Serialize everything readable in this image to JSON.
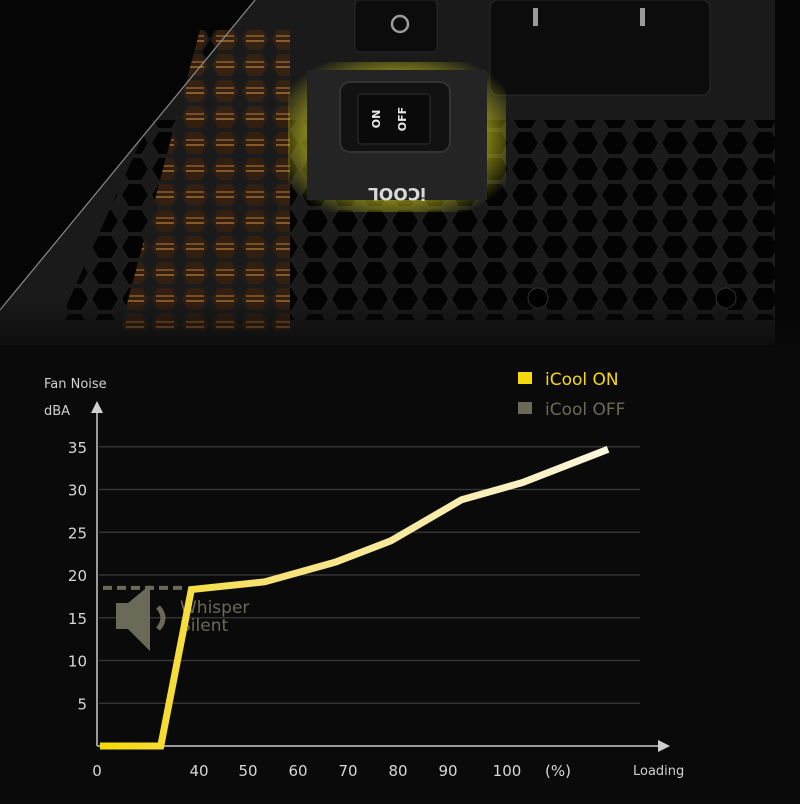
{
  "product_photo": {
    "switch_labels": [
      "ON",
      "OFF"
    ],
    "switch_caption": "iCOOL",
    "highlight_color": "#d6d21a"
  },
  "legend": {
    "items": [
      {
        "label": "iCool ON",
        "color": "#f5d90a"
      },
      {
        "label": "iCool OFF",
        "color": "#6b6a58"
      }
    ]
  },
  "annotation": {
    "line1": "Whisper",
    "line2": "Silent",
    "icon": "speaker-icon",
    "color": "#6b6a58",
    "threshold_dba": 18.5
  },
  "chart_data": {
    "type": "line",
    "title": "",
    "ylabel_line1": "Fan Noise",
    "ylabel_line2": "dBA",
    "xlabel": "Loading",
    "x_unit_label": "(%)",
    "y_ticks": [
      5,
      10,
      15,
      20,
      25,
      30,
      35
    ],
    "x_ticks": [
      0,
      40,
      50,
      60,
      70,
      80,
      90,
      100
    ],
    "ylim": [
      0,
      38
    ],
    "grid": true,
    "legend_position": "top-right",
    "series": [
      {
        "name": "iCool ON",
        "x": [
          0,
          25,
          37,
          53,
          67,
          78,
          92,
          104,
          121
        ],
        "y": [
          0,
          0,
          18.3,
          19.2,
          21.5,
          24.0,
          28.8,
          30.8,
          34.7
        ]
      }
    ]
  }
}
